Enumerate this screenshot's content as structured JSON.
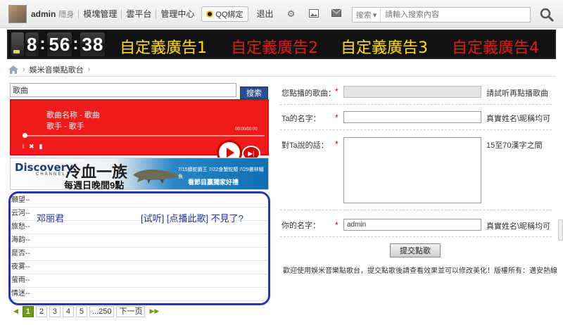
{
  "topbar": {
    "username": "admin",
    "invisible": "隱身",
    "links": [
      "模塊管理",
      "雲平台",
      "管理中心"
    ],
    "qq_bind": "QQ綁定",
    "exit": "退出",
    "icons": [
      "gear-icon",
      "image-icon",
      "mail-icon",
      "bulb-icon"
    ],
    "search_type": "搜索",
    "search_placeholder": "請輸入搜索內容"
  },
  "banner": {
    "clock": {
      "h": "8",
      "m": "56",
      "s": "38"
    },
    "ads": [
      {
        "text": "自定義廣告1",
        "color": "#ffe000"
      },
      {
        "text": "自定義廣告2",
        "color": "#e31b1b"
      },
      {
        "text": "自定義廣告3",
        "color": "#ffe000"
      },
      {
        "text": "自定義廣告4",
        "color": "#e31b1b"
      }
    ]
  },
  "breadcrumb": {
    "page": "娛米音樂點歌台"
  },
  "left": {
    "song_input_value": "歌曲",
    "search_button": "搜索",
    "player": {
      "title": "歌曲名称 - 歌曲",
      "artist": "歌手 - 歌手",
      "time": "00:00/00:00"
    },
    "ad": {
      "logo": "Discovery",
      "channel": "CHANNEL",
      "title": "冷血一族",
      "time": "每週日晚間9點",
      "dates": "7/15蟒蛇霸王 7/22食蟹蛇類 7/29叢林鱷魚",
      "watch": "看節目贏獨家好禮"
    },
    "songs": [
      "願望--",
      "云河--",
      "旅愁--",
      "海韵--",
      "是否--",
      "夜雾--",
      "萤雨--",
      "情迷--"
    ],
    "annotation": {
      "singer": "邓丽君",
      "links": "[试听] [点播此歌] 不見了?"
    },
    "pager": {
      "pages": [
        "1",
        "2",
        "3",
        "4",
        "5",
        "...250"
      ],
      "next": "下一页"
    }
  },
  "form": {
    "song_label": "您點播的歌曲：",
    "song_note": "請試听再點播歌曲",
    "to_label": "Ta的名字：",
    "to_note": "真實姓名\\昵稱均可",
    "msg_label": "對Ta說的話：",
    "msg_note": "15至70漢字之間",
    "name_label": "你的名字：",
    "name_value": "admin",
    "name_note": "真實姓名\\昵稱均可",
    "submit": "提交點歌",
    "footer": "歡迎使用娛米音樂點歌台，提交點歌後請查看效果並可以修改美化！版權所有：邁安熱線",
    "required_mark": "*"
  }
}
